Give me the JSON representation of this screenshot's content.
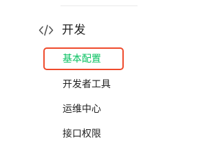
{
  "section": {
    "icon": "code-icon",
    "title": "开发"
  },
  "menu": {
    "items": [
      {
        "label": "基本配置",
        "active": true
      },
      {
        "label": "开发者工具",
        "active": false
      },
      {
        "label": "运维中心",
        "active": false
      },
      {
        "label": "接口权限",
        "active": false
      }
    ]
  },
  "colors": {
    "active": "#07c160",
    "highlight": "#ef4a2b",
    "text": "#1f1f1f"
  }
}
